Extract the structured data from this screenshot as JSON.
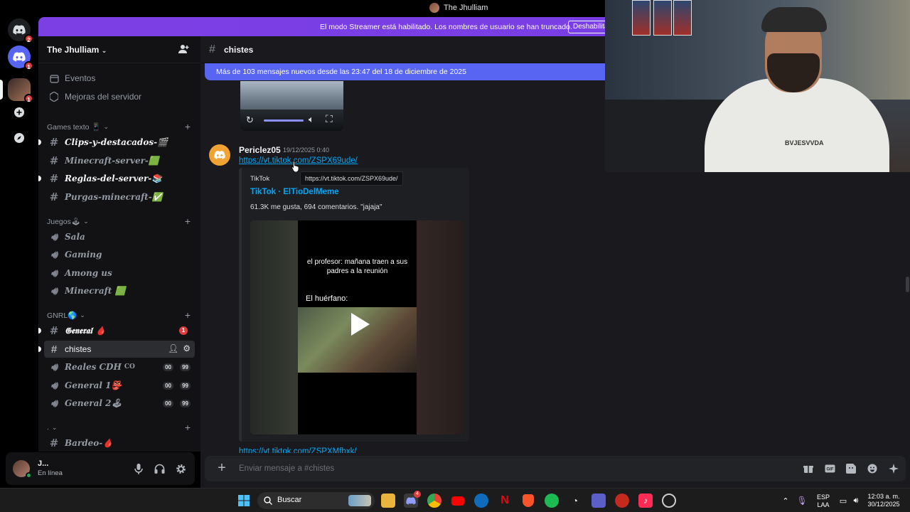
{
  "window": {
    "title": "The Jhulliam"
  },
  "rail": {
    "items": [
      {
        "name": "discord-home",
        "badge": "2"
      },
      {
        "name": "discord-server",
        "badge": "1"
      },
      {
        "name": "user-server",
        "badge": "1"
      },
      {
        "name": "add-server",
        "badge": ""
      },
      {
        "name": "discover",
        "badge": ""
      }
    ]
  },
  "banner": {
    "text": "El modo Streamer está habilitado. Los nombres de usuario se han truncado.",
    "button": "Deshabilitar"
  },
  "server": {
    "name": "The Jhulliam"
  },
  "sidebar": {
    "top_items": [
      {
        "label": "Eventos",
        "icon": "calendar-icon"
      },
      {
        "label": "Mejoras del servidor",
        "icon": "boost-icon"
      }
    ],
    "categories": [
      {
        "label": "Games texto 📱",
        "channels": [
          {
            "label": "Clips-y-destacados-🎬",
            "type": "text",
            "style": "bold",
            "unread": true
          },
          {
            "label": "Minecraft-server-🟩",
            "type": "text",
            "style": "italic",
            "unread": false
          },
          {
            "label": "Reglas-del-server-📚",
            "type": "text",
            "style": "bold",
            "unread": true
          },
          {
            "label": "Purgas-minecraft-✅",
            "type": "text",
            "style": "italic",
            "unread": false
          }
        ]
      },
      {
        "label": "Juegos🕹",
        "channels": [
          {
            "label": "Sala",
            "type": "voice"
          },
          {
            "label": "Gaming",
            "type": "voice"
          },
          {
            "label": "Among us",
            "type": "voice"
          },
          {
            "label": "Minecraft 🟩",
            "type": "voice"
          }
        ]
      },
      {
        "label": "GNRL🌎",
        "channels": [
          {
            "label": "𝕲𝖊𝖓𝖊𝖗𝖆𝖑 🩸",
            "type": "text",
            "badge": "1",
            "unread": true
          },
          {
            "label": "chistes",
            "type": "text",
            "active": true
          },
          {
            "label": "Reales CDH",
            "suffix": "CO",
            "type": "voice",
            "pills": [
              "00",
              "99"
            ]
          },
          {
            "label": "General 1👺",
            "type": "voice",
            "pills": [
              "00",
              "99"
            ]
          },
          {
            "label": "General 2🕹",
            "type": "voice",
            "pills": [
              "00",
              "99"
            ]
          }
        ]
      },
      {
        "label": ".",
        "channels": [
          {
            "label": "Bardeo-🩸",
            "type": "text"
          }
        ]
      }
    ]
  },
  "user": {
    "name": "J...",
    "status": "En línea"
  },
  "channel": {
    "name": "chistes"
  },
  "new_messages_bar": "Más de 103 mensajes nuevos desde las 23:47 del 18 de diciembre de 2025",
  "message": {
    "author": "Periclez05",
    "timestamp": "19/12/2025 0:40",
    "link": "https://vt.tiktok.com/ZSPX69ude/",
    "tooltip": "https://vt.tiktok.com/ZSPX69ude/",
    "embed": {
      "provider": "TikTok",
      "title": "TikTok · ElTioDelMeme",
      "description": "61.3K me gusta, 694 comentarios. \"jajaja\"",
      "caption_top": "el profesor: mañana traen a sus padres a la reunión",
      "caption_bottom": "El huérfano:"
    },
    "next_link": "https://vt.tiktok.com/ZSPXMfbxk/"
  },
  "composer": {
    "placeholder": "Enviar mensaje a #chistes"
  },
  "taskbar": {
    "search": "Buscar",
    "lang_top": "ESP",
    "lang_bottom": "LAA",
    "time": "12:03 a. m.",
    "date": "30/12/2025",
    "discord_badge": "4"
  },
  "webcam": {
    "shirt_text": "BVJESVVDA"
  },
  "colors": {
    "accent": "#5865f2",
    "banner": "#7a3fe4",
    "link": "#00a8fc",
    "badge": "#e03e3e",
    "online": "#23a55a"
  }
}
